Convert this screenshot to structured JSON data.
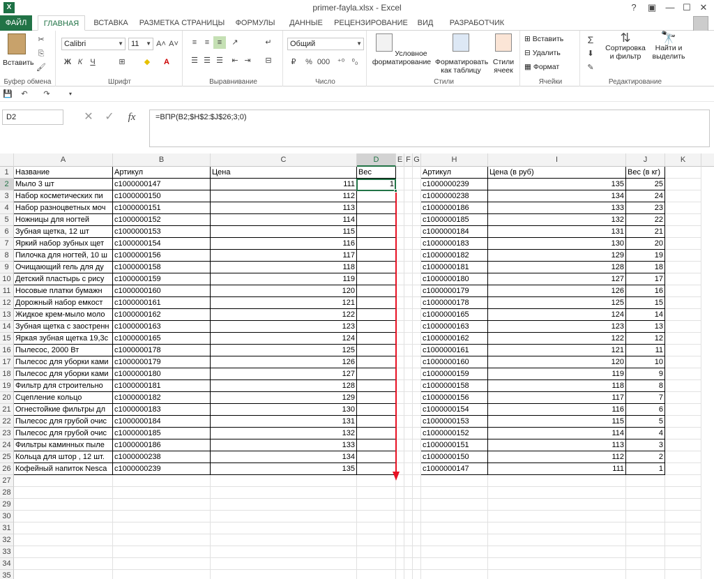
{
  "window": {
    "title": "primer-fayla.xlsx - Excel",
    "controls": [
      "?",
      "▣",
      "—",
      "☐",
      "✕"
    ]
  },
  "tabs": [
    "ФАЙЛ",
    "ГЛАВНАЯ",
    "ВСТАВКА",
    "РАЗМЕТКА СТРАНИЦЫ",
    "ФОРМУЛЫ",
    "ДАННЫЕ",
    "РЕЦЕНЗИРОВАНИЕ",
    "ВИД",
    "РАЗРАБОТЧИК"
  ],
  "ribbon": {
    "clipboard": {
      "paste": "Вставить",
      "label": "Буфер обмена"
    },
    "font": {
      "name": "Calibri",
      "size": "11",
      "label": "Шрифт",
      "bold": "Ж",
      "italic": "К",
      "underline": "Ч"
    },
    "alignment": {
      "label": "Выравнивание"
    },
    "number": {
      "format": "Общий",
      "label": "Число"
    },
    "styles": {
      "conditional": "Условное форматирование",
      "as_table": "Форматировать как таблицу",
      "cell_styles": "Стили ячеек",
      "label": "Стили"
    },
    "cells": {
      "insert": "Вставить",
      "delete": "Удалить",
      "format": "Формат",
      "label": "Ячейки"
    },
    "editing": {
      "sort": "Сортировка и фильтр",
      "find": "Найти и выделить",
      "label": "Редактирование"
    }
  },
  "formula_bar": {
    "name_box": "D2",
    "formula": "=ВПР(B2;$H$2:$J$26;3;0)",
    "fx": "fx"
  },
  "columns": [
    "A",
    "B",
    "C",
    "D",
    "E",
    "F",
    "G",
    "H",
    "I",
    "J",
    "K"
  ],
  "headers": {
    "A": "Название",
    "B": "Артикул",
    "C": "Цена",
    "D": "Вес",
    "H": "Артикул",
    "I": "Цена (в руб)",
    "J": "Вес (в кг)"
  },
  "left_table": [
    [
      "Мыло 3 шт",
      "c1000000147",
      "111",
      "1"
    ],
    [
      "Набор косметических пи",
      "c1000000150",
      "112",
      ""
    ],
    [
      "Набор разноцветных моч",
      "c1000000151",
      "113",
      ""
    ],
    [
      "Ножницы для ногтей",
      "c1000000152",
      "114",
      ""
    ],
    [
      "Зубная щетка, 12 шт",
      "c1000000153",
      "115",
      ""
    ],
    [
      "Яркий набор зубных щет",
      "c1000000154",
      "116",
      ""
    ],
    [
      "Пилочка для ногтей, 10 ш",
      "c1000000156",
      "117",
      ""
    ],
    [
      "Очищающий гель для ду",
      "c1000000158",
      "118",
      ""
    ],
    [
      "Детский пластырь с рису",
      "c1000000159",
      "119",
      ""
    ],
    [
      "Носовые платки бумажн",
      "c1000000160",
      "120",
      ""
    ],
    [
      "Дорожный набор емкост",
      "c1000000161",
      "121",
      ""
    ],
    [
      "Жидкое крем-мыло моло",
      "c1000000162",
      "122",
      ""
    ],
    [
      "Зубная щетка с заостренн",
      "c1000000163",
      "123",
      ""
    ],
    [
      "Яркая зубная щетка 19,3с",
      "c1000000165",
      "124",
      ""
    ],
    [
      "Пылесос, 2000 Вт",
      "c1000000178",
      "125",
      ""
    ],
    [
      "Пылесос для уборки ками",
      "c1000000179",
      "126",
      ""
    ],
    [
      "Пылесос для уборки ками",
      "c1000000180",
      "127",
      ""
    ],
    [
      "Фильтр для строительно",
      "c1000000181",
      "128",
      ""
    ],
    [
      "Сцепление кольцо",
      "c1000000182",
      "129",
      ""
    ],
    [
      "Огнестойкие фильтры дл",
      "c1000000183",
      "130",
      ""
    ],
    [
      "Пылесос для грубой очис",
      "c1000000184",
      "131",
      ""
    ],
    [
      "Пылесос для грубой очис",
      "c1000000185",
      "132",
      ""
    ],
    [
      "Фильтры каминных пыле",
      "c1000000186",
      "133",
      ""
    ],
    [
      "Кольца для штор , 12 шт.",
      "c1000000238",
      "134",
      ""
    ],
    [
      "Кофейный напиток Nesca",
      "c1000000239",
      "135",
      ""
    ]
  ],
  "right_table": [
    [
      "c1000000239",
      "135",
      "25"
    ],
    [
      "c1000000238",
      "134",
      "24"
    ],
    [
      "c1000000186",
      "133",
      "23"
    ],
    [
      "c1000000185",
      "132",
      "22"
    ],
    [
      "c1000000184",
      "131",
      "21"
    ],
    [
      "c1000000183",
      "130",
      "20"
    ],
    [
      "c1000000182",
      "129",
      "19"
    ],
    [
      "c1000000181",
      "128",
      "18"
    ],
    [
      "c1000000180",
      "127",
      "17"
    ],
    [
      "c1000000179",
      "126",
      "16"
    ],
    [
      "c1000000178",
      "125",
      "15"
    ],
    [
      "c1000000165",
      "124",
      "14"
    ],
    [
      "c1000000163",
      "123",
      "13"
    ],
    [
      "c1000000162",
      "122",
      "12"
    ],
    [
      "c1000000161",
      "121",
      "11"
    ],
    [
      "c1000000160",
      "120",
      "10"
    ],
    [
      "c1000000159",
      "119",
      "9"
    ],
    [
      "c1000000158",
      "118",
      "8"
    ],
    [
      "c1000000156",
      "117",
      "7"
    ],
    [
      "c1000000154",
      "116",
      "6"
    ],
    [
      "c1000000153",
      "115",
      "5"
    ],
    [
      "c1000000152",
      "114",
      "4"
    ],
    [
      "c1000000151",
      "113",
      "3"
    ],
    [
      "c1000000150",
      "112",
      "2"
    ],
    [
      "c1000000147",
      "111",
      "1"
    ]
  ],
  "row_count": 35,
  "colors": {
    "excel_green": "#217346",
    "arrow": "#e81123"
  }
}
